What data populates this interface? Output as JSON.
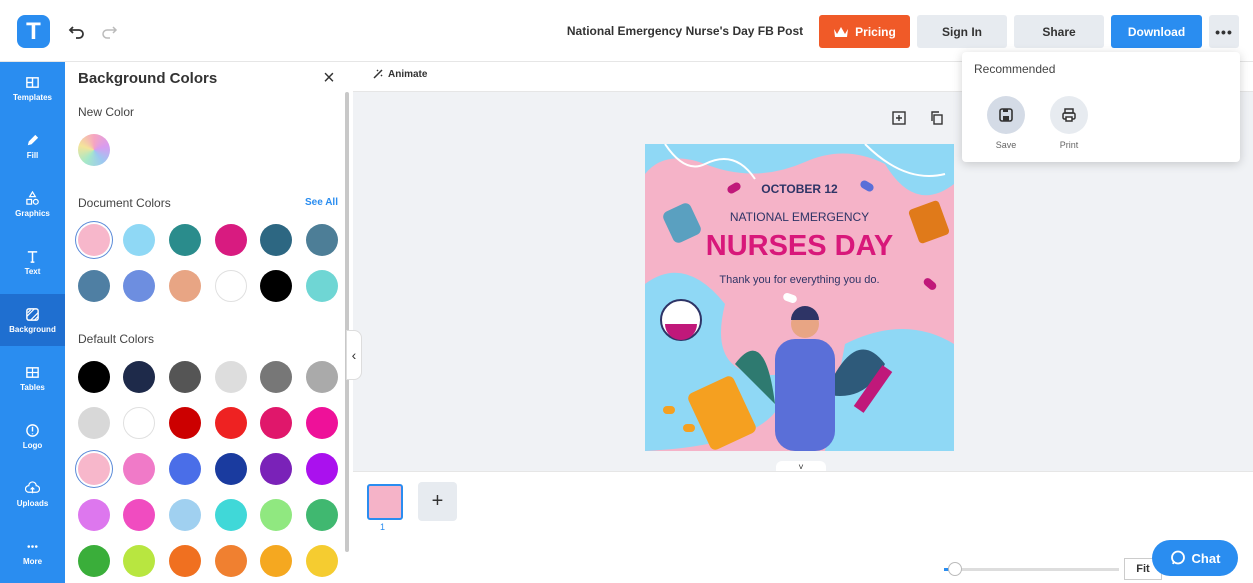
{
  "app": {
    "logo_letter": "T",
    "doc_title": "National Emergency Nurse's Day FB Post"
  },
  "topbar": {
    "pricing_label": "Pricing",
    "signin_label": "Sign In",
    "share_label": "Share",
    "download_label": "Download",
    "more_label": "•••"
  },
  "rail": {
    "items": [
      {
        "label": "Templates",
        "icon": "templates-icon"
      },
      {
        "label": "Fill",
        "icon": "pen-icon"
      },
      {
        "label": "Graphics",
        "icon": "shapes-icon"
      },
      {
        "label": "Text",
        "icon": "text-icon"
      },
      {
        "label": "Background",
        "icon": "background-icon",
        "active": true
      },
      {
        "label": "Tables",
        "icon": "table-icon"
      },
      {
        "label": "Logo",
        "icon": "logo-icon"
      },
      {
        "label": "Uploads",
        "icon": "upload-icon"
      },
      {
        "label": "More",
        "icon": "more-icon"
      }
    ]
  },
  "panel": {
    "title": "Background Colors",
    "close_label": "×",
    "new_color_label": "New Color",
    "document_colors_label": "Document Colors",
    "see_all_label": "See All",
    "default_colors_label": "Default Colors",
    "document_colors": [
      "#f7b7cb",
      "#8fd8f5",
      "#2a8c8c",
      "#d81b80",
      "#2d6782",
      "#4d7e97",
      "#4f7fa3",
      "#6d8ee0",
      "#e8a584",
      "#ffffff",
      "#000000",
      "#6fd6d4"
    ],
    "default_colors": [
      "#000000",
      "#1e2a4a",
      "#555555",
      "#dddddd",
      "#777777",
      "#aaaaaa",
      "#d8d8d8",
      "#ffffff",
      "#cc0000",
      "#ee2222",
      "#e0176b",
      "#ee1199",
      "#f7b7cb",
      "#f07ac8",
      "#4a6ee8",
      "#1a3b9f",
      "#7a22b8",
      "#aa11ee",
      "#dd77ee",
      "#f04cc0",
      "#a0d0f0",
      "#40d8d8",
      "#90e880",
      "#40b870",
      "#3aae3a",
      "#b8e640",
      "#f07020",
      "#f08030",
      "#f5a820",
      "#f5cc30"
    ]
  },
  "canvas": {
    "animate_label": "Animate",
    "design": {
      "date": "OCTOBER 12",
      "subtitle": "NATIONAL EMERGENCY",
      "title": "NURSES DAY",
      "thanks": "Thank you for everything you do."
    }
  },
  "pages": {
    "current": "1",
    "add_label": "+"
  },
  "zoom": {
    "fit_label": "Fit",
    "level": 0.06
  },
  "chat": {
    "label": "Chat"
  },
  "dropdown": {
    "title": "Recommended",
    "items": [
      {
        "label": "Save",
        "icon": "save-icon"
      },
      {
        "label": "Print",
        "icon": "print-icon"
      }
    ]
  }
}
